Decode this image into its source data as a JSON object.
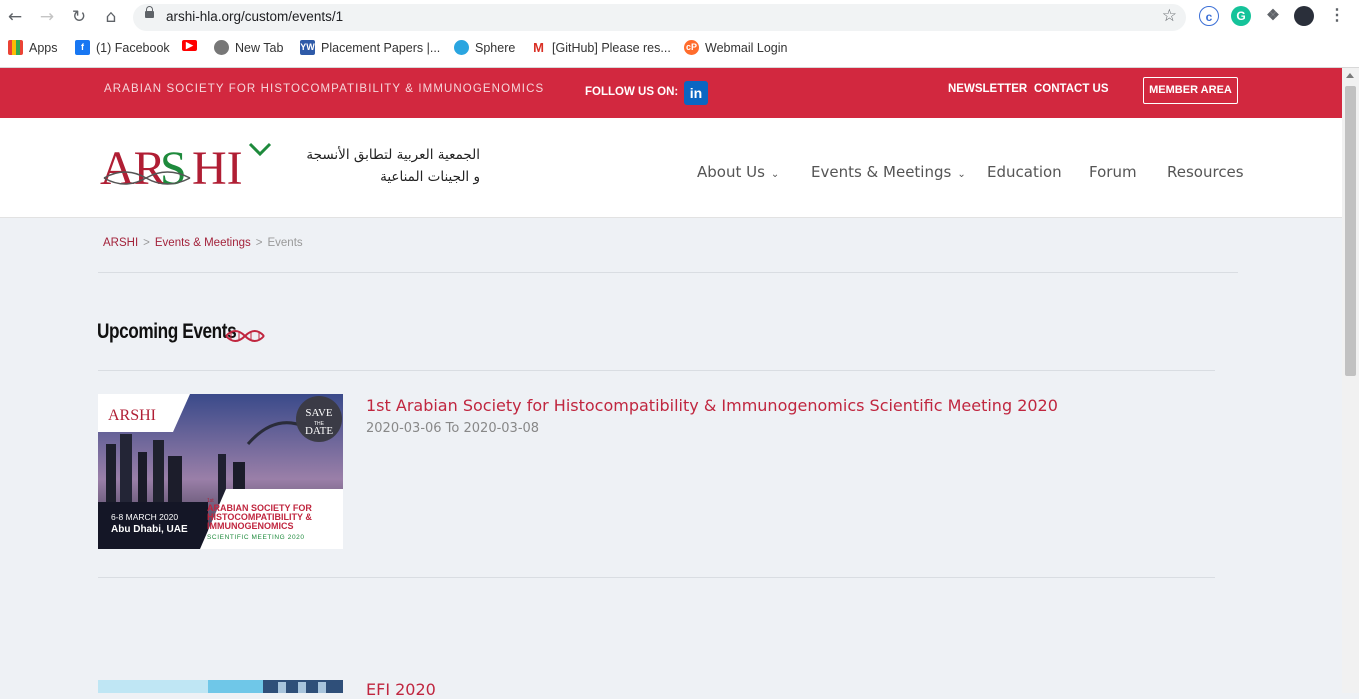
{
  "browser": {
    "url": "arshi-hla.org/custom/events/1",
    "bookmarks": [
      {
        "label": "Apps"
      },
      {
        "label": "(1) Facebook"
      },
      {
        "label": "New Tab"
      },
      {
        "label": "Placement Papers |..."
      },
      {
        "label": "Sphere"
      },
      {
        "label": "[GitHub] Please res..."
      },
      {
        "label": "Webmail Login"
      }
    ]
  },
  "topbar": {
    "society": "ARABIAN SOCIETY FOR HISTOCOMPATIBILITY & IMMUNOGENOMICS",
    "follow": "FOLLOW US ON:",
    "linkedin": "in",
    "newsletter": "NEWSLETTER",
    "contact": "CONTACT US",
    "member": "MEMBER AREA"
  },
  "header": {
    "logo_text": "ARSHI",
    "arabic_line1": "الجمعية العربية لتطابق الأنسجة",
    "arabic_line2": "و الجينات المناعية",
    "menu": [
      {
        "label": "About Us"
      },
      {
        "label": "Events & Meetings"
      },
      {
        "label": "Education"
      },
      {
        "label": "Forum"
      },
      {
        "label": "Resources"
      }
    ]
  },
  "breadcrumb": {
    "home": "ARSHI",
    "sep": ">",
    "section": "Events & Meetings",
    "current": "Events"
  },
  "main": {
    "title": "Upcoming Events",
    "events": [
      {
        "title": "1st Arabian Society for Histocompatibility & Immunogenomics Scientific Meeting 2020",
        "date": "2020-03-06 To 2020-03-08",
        "thumb": {
          "logo": "ARSHI",
          "save": "SAVE",
          "the": "THE",
          "date_word": "DATE",
          "when": "6-8 MARCH 2020",
          "where": "Abu Dhabi, UAE",
          "ordinal": "1st",
          "line1": "ARABIAN SOCIETY FOR",
          "line2": "HISTOCOMPATIBILITY &",
          "line3": "IMMUNOGENOMICS",
          "line4": "SCIENTIFIC MEETING 2020"
        }
      },
      {
        "title": "EFI 2020",
        "date": ""
      }
    ]
  },
  "colors": {
    "brand_red": "#d2283f",
    "title_red": "#c0263f",
    "logo_green": "#1e8a3c"
  }
}
